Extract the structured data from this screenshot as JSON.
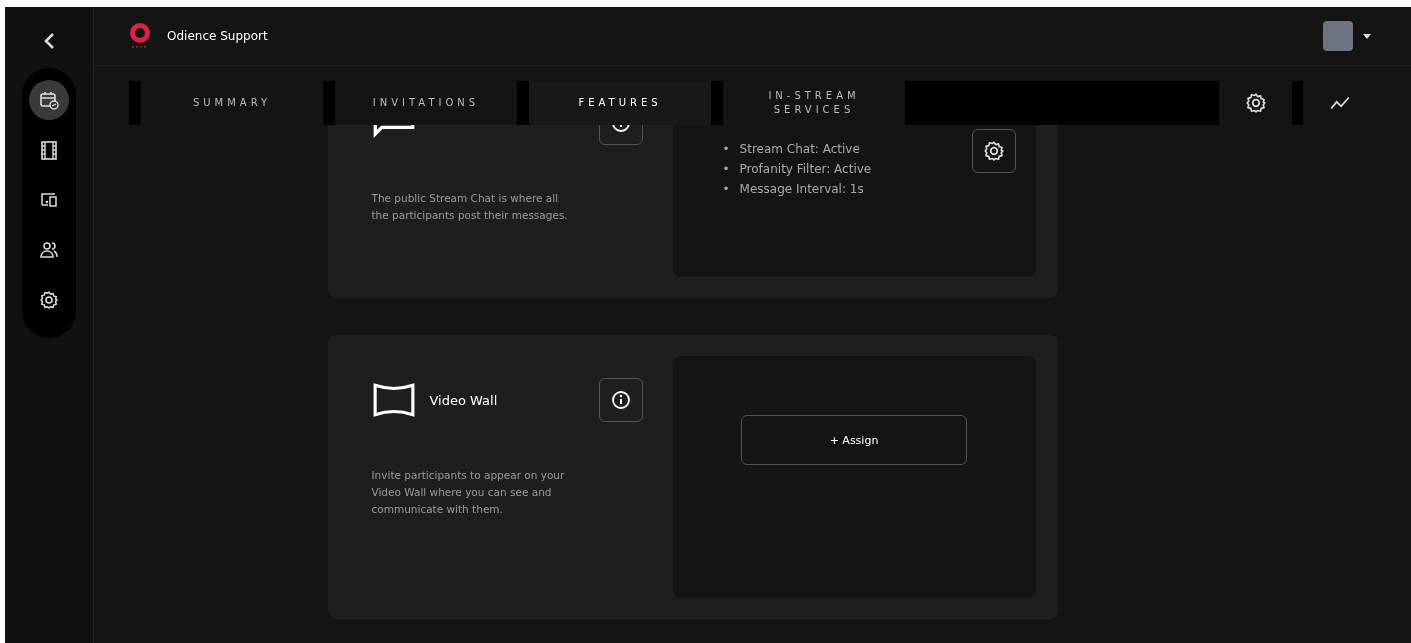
{
  "header": {
    "account_name": "Odience Support"
  },
  "sidebar": {
    "items": [
      {
        "selected": true
      },
      {
        "selected": false
      },
      {
        "selected": false
      },
      {
        "selected": false
      },
      {
        "selected": false
      }
    ]
  },
  "tabs": [
    {
      "label": "SUMMARY",
      "selected": false
    },
    {
      "label": "INVITATIONS",
      "selected": false
    },
    {
      "label": "FEATURES",
      "selected": true
    },
    {
      "label": "IN-STREAM\nSERVICES",
      "selected": false
    }
  ],
  "features": [
    {
      "kind": "active",
      "description": "The public Stream Chat is where all the participants post their messages.",
      "settings": [
        {
          "bullet": "•",
          "text": "Stream Chat: Active"
        },
        {
          "bullet": "•",
          "text": "Profanity Filter: Active"
        },
        {
          "bullet": "•",
          "text": "Message Interval: 1s"
        }
      ]
    },
    {
      "kind": "unassigned",
      "title": "Video Wall",
      "description": "Invite participants to appear on your Video Wall where you can see and communicate with them.",
      "assign_label": "+ Assign"
    }
  ]
}
